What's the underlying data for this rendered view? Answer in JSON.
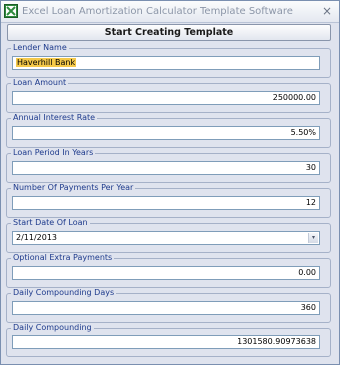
{
  "window": {
    "title": "Excel Loan Amortization Calculator Template Software",
    "close_symbol": "×"
  },
  "start_button": {
    "label": "Start Creating Template"
  },
  "fields": {
    "lender_name": {
      "label": "Lender Name",
      "value": "Haverhill Bank"
    },
    "loan_amount": {
      "label": "Loan Amount",
      "value": "250000.00"
    },
    "annual_interest_rate": {
      "label": "Annual Interest Rate",
      "value": "5.50%"
    },
    "loan_period": {
      "label": "Loan Period In Years",
      "value": "30"
    },
    "payments_per_year": {
      "label": "Number Of Payments Per Year",
      "value": "12"
    },
    "start_date": {
      "label": "Start Date Of Loan",
      "value": "2/11/2013",
      "dropdown_symbol": "▾"
    },
    "extra_payments": {
      "label": "Optional Extra Payments",
      "value": "0.00"
    },
    "compounding_days": {
      "label": "Daily Compounding Days",
      "value": "360"
    },
    "daily_compounding": {
      "label": "Daily Compounding",
      "value": "1301580.90973638"
    }
  },
  "colors": {
    "window_bg": "#dfe3ee",
    "group_label": "#1d3a8c",
    "selection": "#f5c94a"
  },
  "icons": {
    "app": "excel-icon",
    "close": "close-icon",
    "dropdown": "chevron-down-icon"
  }
}
